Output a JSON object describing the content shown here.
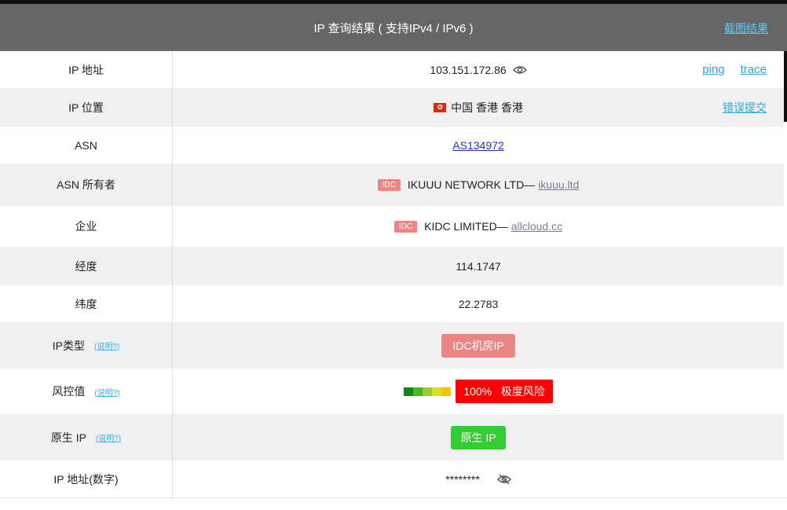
{
  "header": {
    "title": "IP 查询结果 ( 支持IPv4 / IPv6 )",
    "screenshot_link": "截图结果"
  },
  "rows": {
    "ip": {
      "label": "IP 地址",
      "value": "103.151.172.86",
      "ping": "ping",
      "trace": "trace"
    },
    "location": {
      "label": "IP 位置",
      "value": "中国 香港 香港",
      "report": "错误提交"
    },
    "asn": {
      "label": "ASN",
      "value": "AS134972"
    },
    "asn_owner": {
      "label": "ASN 所有者",
      "tag": "IDC",
      "name": "IKUUU NETWORK LTD—",
      "domain": "ikuuu.ltd"
    },
    "company": {
      "label": "企业",
      "tag": "IDC",
      "name": "KIDC LIMITED—",
      "domain": "allcloud.cc"
    },
    "longitude": {
      "label": "经度",
      "value": "114.1747"
    },
    "latitude": {
      "label": "纬度",
      "value": "22.2783"
    },
    "ip_type": {
      "label": "IP类型",
      "help": "(说明?)",
      "value": "IDC机房IP"
    },
    "risk": {
      "label": "风控值",
      "help": "(说明?)",
      "percent": "100%",
      "level": "极度风险",
      "meter_colors": [
        "#118811",
        "#44bb22",
        "#99cc33",
        "#dddd22",
        "#f3c400"
      ]
    },
    "native": {
      "label": "原生 IP",
      "help": "(说明?)",
      "value": "原生 IP"
    },
    "ip_numeric": {
      "label": "IP 地址(数字)",
      "value": "********"
    }
  }
}
